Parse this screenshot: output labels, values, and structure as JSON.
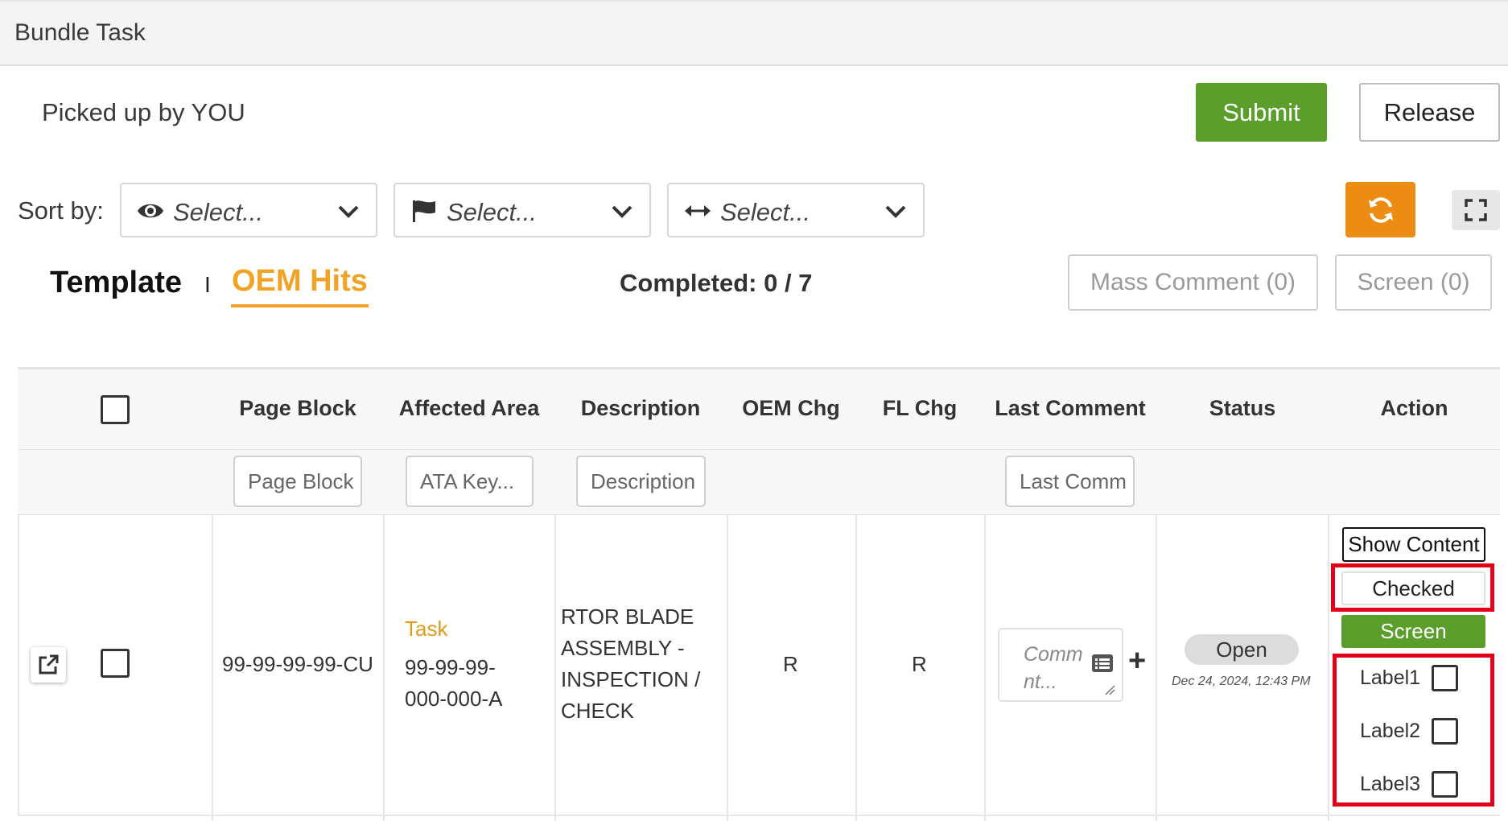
{
  "header": {
    "title": "Bundle Task"
  },
  "pickup": {
    "text": "Picked up by YOU"
  },
  "actions": {
    "submit_label": "Submit",
    "release_label": "Release"
  },
  "sort": {
    "label": "Sort by:",
    "selects": [
      {
        "icon": "eye-icon",
        "placeholder": "Select..."
      },
      {
        "icon": "flag-icon",
        "placeholder": "Select..."
      },
      {
        "icon": "horizontal-arrows-icon",
        "placeholder": "Select..."
      }
    ]
  },
  "tabs": {
    "template": "Template",
    "separator": "I",
    "oem_hits": "OEM Hits"
  },
  "completed": {
    "text": "Completed: 0 / 7"
  },
  "mass": {
    "mass_comment_label": "Mass Comment (0)",
    "screen_label": "Screen (0)"
  },
  "table": {
    "headers": {
      "page_block": "Page Block",
      "affected_area": "Affected Area",
      "description": "Description",
      "oem_chg": "OEM Chg",
      "fl_chg": "FL Chg",
      "last_comment": "Last Comment",
      "status": "Status",
      "action": "Action"
    },
    "filters": {
      "page_block": "Page Block",
      "ata_key": "ATA Key...",
      "description": "Description",
      "last_comment": "Last Comm"
    },
    "rows": [
      {
        "page_block": "99-99-99-99-CU",
        "affected_type": "Task",
        "affected_line1": "99-99-99-",
        "affected_line2": "000-000-A",
        "desc_line1": "RTOR BLADE",
        "desc_line2": "ASSEMBLY -",
        "desc_line3": "INSPECTION /",
        "desc_line4": "CHECK",
        "oem_chg": "R",
        "fl_chg": "R",
        "comment_placeholder_1": "Comm",
        "comment_placeholder_2": "nt...",
        "status": "Open",
        "status_date": "Dec 24, 2024, 12:43 PM",
        "action_show": "Show Content",
        "action_checked": "Checked",
        "action_screen": "Screen",
        "labels": [
          "Label1",
          "Label2",
          "Label3"
        ]
      }
    ]
  },
  "colors": {
    "green": "#5a9e2b",
    "orange": "#ec8c12",
    "accent": "#f0a325",
    "highlight": "#e3001b"
  }
}
